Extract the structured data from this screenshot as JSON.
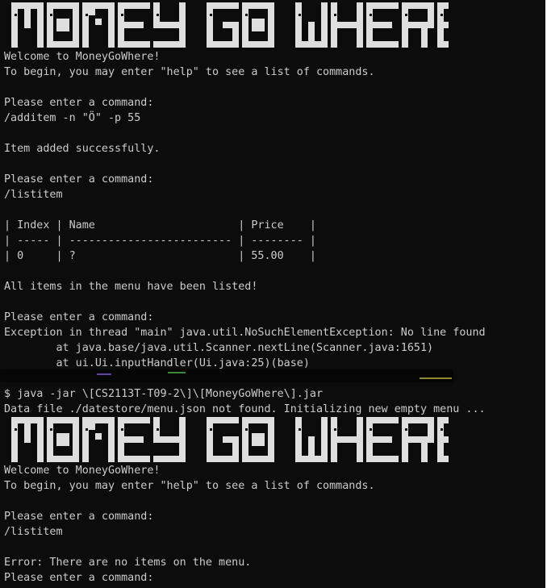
{
  "banner_text": "MONEY GO WHERE",
  "session1": {
    "welcome": "Welcome to MoneyGoWhere!",
    "help_hint": "To begin, you may enter \"help\" to see a list of commands.",
    "prompt1": "Please enter a command:",
    "cmd1": "/additem -n \"Ö\" -p 55",
    "result1": "Item added successfully.",
    "prompt2": "Please enter a command:",
    "cmd2": "/listitem",
    "table": {
      "header": "| Index | Name                      | Price    |",
      "separator": "| ----- | ------------------------- | -------- |",
      "rows": [
        "| 0     | ?                         | 55.00    |"
      ]
    },
    "listed": "All items in the menu have been listed!",
    "prompt3": "Please enter a command:",
    "exception": "Exception in thread \"main\" java.util.NoSuchElementException: No line found",
    "trace1": "        at java.base/java.util.Scanner.nextLine(Scanner.java:1651)",
    "trace2": "        at ui.Ui.inputHandler(Ui.java:25)(base)"
  },
  "shell_command": "$ java -jar \\[CS2113T-T09-2\\]\\[MoneyGoWhere\\].jar",
  "datafile_msg": "Data file ./datestore/menu.json not found. Initializing new empty menu ...",
  "session2": {
    "welcome": "Welcome to MoneyGoWhere!",
    "help_hint": "To begin, you may enter \"help\" to see a list of commands.",
    "prompt1": "Please enter a command:",
    "cmd1": "/listitem",
    "error": "Error: There are no items on the menu.",
    "prompt2": "Please enter a command:"
  },
  "colors": {
    "background": "#0c0c0c",
    "text": "#cccccc",
    "banner": "#dedede"
  }
}
